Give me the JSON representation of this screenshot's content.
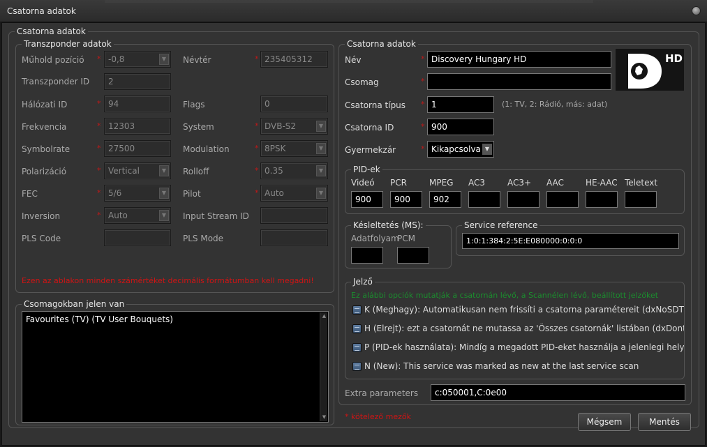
{
  "window": {
    "title": "Csatorna adatok"
  },
  "outer_group": {
    "title": "Csatorna adatok"
  },
  "transponder": {
    "title": "Transzponder adatok",
    "satellite_position": {
      "label": "Műhold pozíció",
      "value": "-0,8"
    },
    "namespace": {
      "label": "Névtér",
      "value": "235405312"
    },
    "transponder_id": {
      "label": "Transzponder ID",
      "value": "2"
    },
    "network_id": {
      "label": "Hálózati ID",
      "value": "94"
    },
    "flags": {
      "label": "Flags",
      "value": "0"
    },
    "frequency": {
      "label": "Frekvencia",
      "value": "12303"
    },
    "system": {
      "label": "System",
      "value": "DVB-S2"
    },
    "symbolrate": {
      "label": "Symbolrate",
      "value": "27500"
    },
    "modulation": {
      "label": "Modulation",
      "value": "8PSK"
    },
    "polarization": {
      "label": "Polarizáció",
      "value": "Vertical"
    },
    "rolloff": {
      "label": "Rolloff",
      "value": "0.35"
    },
    "fec": {
      "label": "FEC",
      "value": "5/6"
    },
    "pilot": {
      "label": "Pilot",
      "value": "Auto"
    },
    "inversion": {
      "label": "Inversion",
      "value": "Auto"
    },
    "input_stream_id": {
      "label": "Input Stream ID",
      "value": ""
    },
    "pls_code": {
      "label": "PLS Code",
      "value": ""
    },
    "pls_mode": {
      "label": "PLS Mode",
      "value": ""
    },
    "warning": "Ezen az ablakon minden számértéket decimális formátumban kell megadni!"
  },
  "bouquets": {
    "title": "Csomagokban jelen van",
    "items": [
      "Favourites (TV) (TV User Bouquets)"
    ]
  },
  "channel": {
    "title": "Csatorna adatok",
    "name": {
      "label": "Név",
      "value": "Discovery Hungary HD"
    },
    "package": {
      "label": "Csomag",
      "value": ""
    },
    "type": {
      "label": "Csatorna típus",
      "value": "1",
      "hint": "(1: TV, 2: Rádió, más: adat)"
    },
    "channel_id": {
      "label": "Csatorna ID",
      "value": "900"
    },
    "parental_lock": {
      "label": "Gyermekzár",
      "value": "Kikapcsolva"
    },
    "logo": {
      "badge": "HD"
    }
  },
  "pids": {
    "title": "PID-ek",
    "columns": [
      {
        "label": "Videó",
        "value": "900"
      },
      {
        "label": "PCR",
        "value": "900"
      },
      {
        "label": "MPEG",
        "value": "902"
      },
      {
        "label": "AC3",
        "value": ""
      },
      {
        "label": "AC3+",
        "value": ""
      },
      {
        "label": "AAC",
        "value": ""
      },
      {
        "label": "HE-AAC",
        "value": ""
      },
      {
        "label": "Teletext",
        "value": ""
      }
    ]
  },
  "delay": {
    "title": "Késleltetés (MS):",
    "stream_label": "Adatfolyam",
    "pcm_label": "PCM",
    "stream_value": "",
    "pcm_value": ""
  },
  "service_reference": {
    "title": "Service reference",
    "value": "1:0:1:384:2:5E:E080000:0:0:0"
  },
  "flags_group": {
    "title": "Jelző",
    "hint": "Ez alábbi opciók mutatják a csatornán lévő, a Scannélen lévő, beállí­tott jelzőket",
    "items": [
      {
        "text": "K (Meghagy): Automatikusan nem frissíti a csatorna paraméte­reit (dxNoSDT)"
      },
      {
        "text": "H (Elrejt): ezt a csatornát ne mutassa az 'Összes csatornák' listában (dxDontshow)"
      },
      {
        "text": "P (PID-ek használata): Mindíg a megadott PID-eket használja a jelenlegi helyett (dxNoDV"
      },
      {
        "text": "N (New): This service was marked as new at the last service scan"
      }
    ]
  },
  "extra": {
    "label": "Extra parameters",
    "value": "c:050001,C:0e00"
  },
  "required_note": "* kötelező mezők",
  "buttons": {
    "cancel": "Mégsem",
    "save": "Mentés"
  },
  "colors": {
    "required": "#c01818",
    "hint_green": "#1b8e2e",
    "warning_red": "#d01414"
  }
}
